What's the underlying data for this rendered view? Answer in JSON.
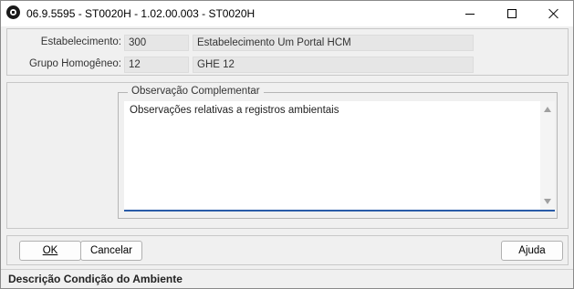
{
  "window": {
    "title": "06.9.5595 - ST0020H - 1.02.00.003 - ST0020H",
    "icon": "app-logo-icon"
  },
  "header": {
    "estabelecimento_label": "Estabelecimento:",
    "estabelecimento_code": "300",
    "estabelecimento_name": "Estabelecimento Um Portal HCM",
    "grupo_label": "Grupo Homogêneo:",
    "grupo_code": "12",
    "grupo_name": "GHE 12"
  },
  "observacao": {
    "group_title": "Observação Complementar",
    "text": "Observações relativas a registros ambientais"
  },
  "buttons": {
    "ok": "OK",
    "cancel": "Cancelar",
    "help": "Ajuda"
  },
  "status": {
    "text": "Descrição Condição do Ambiente"
  },
  "colors": {
    "accent_underline": "#2a5ca8",
    "background": "#f0f0f0"
  }
}
